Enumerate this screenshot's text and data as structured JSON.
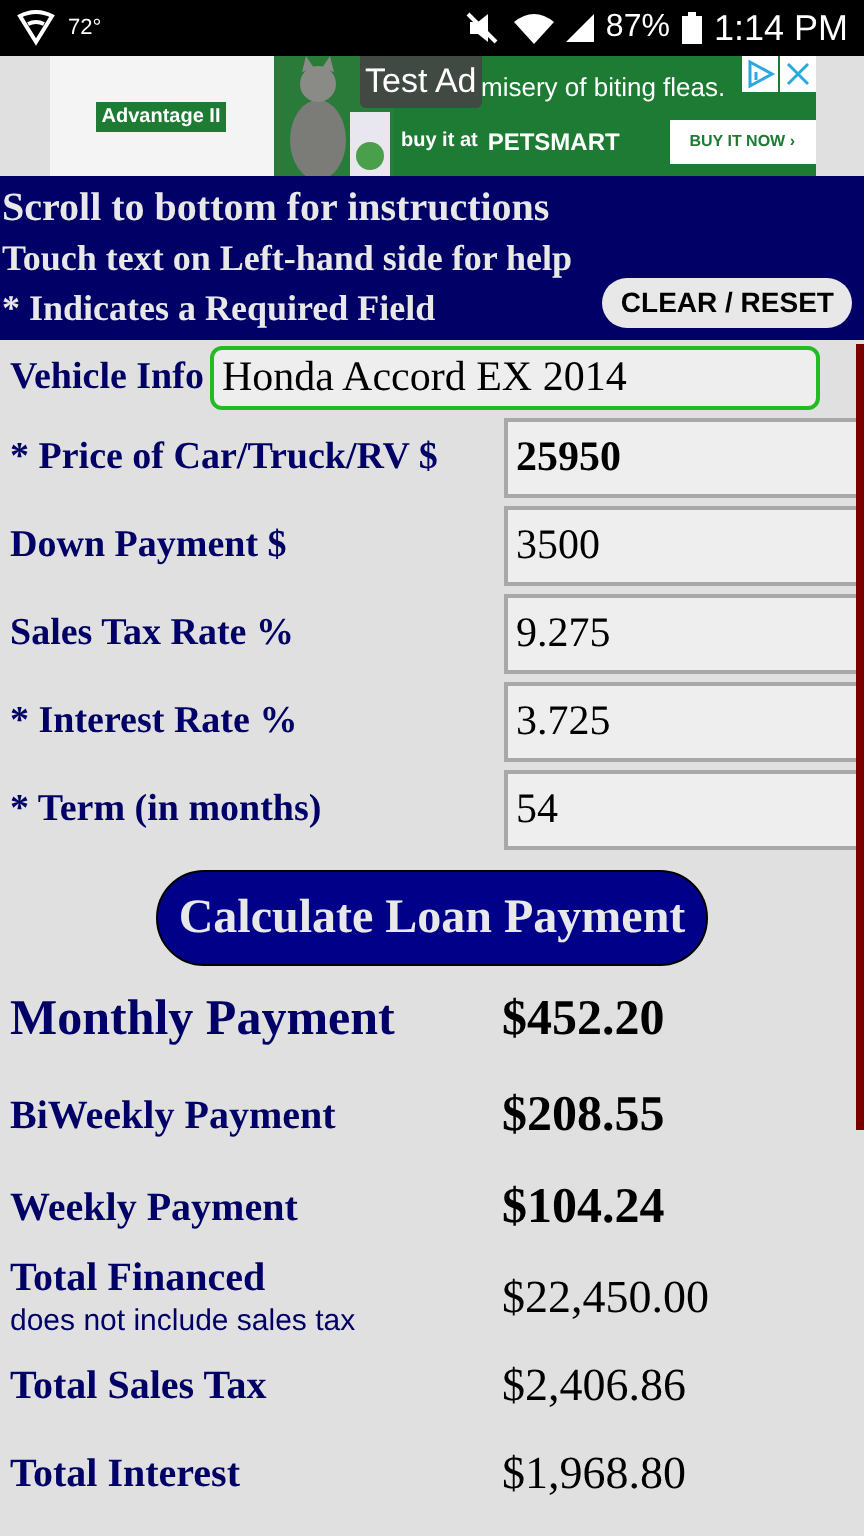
{
  "status_bar": {
    "temperature": "72°",
    "battery": "87%",
    "time": "1:14 PM"
  },
  "ad": {
    "label": "Test Ad",
    "brand": "Advantage II",
    "headline": "misery of biting fleas.",
    "buy_at": "buy it at",
    "store": "PETSMART",
    "cta": "BUY IT NOW ›"
  },
  "header": {
    "lines": [
      "Scroll to bottom for instructions",
      "Touch text on Left-hand side for help",
      "* Indicates a Required Field"
    ],
    "reset_button": "CLEAR / RESET"
  },
  "fields": [
    {
      "kind": "wide",
      "label": "Vehicle Info",
      "value": "Honda Accord EX 2014",
      "focused": true,
      "bold": false
    },
    {
      "kind": "box",
      "label": "* Price of Car/Truck/RV $",
      "value": "25950",
      "focused": false,
      "bold": true
    },
    {
      "kind": "box",
      "label": "Down Payment $",
      "value": "3500",
      "focused": false,
      "bold": false
    },
    {
      "kind": "box",
      "label": "Sales Tax Rate %",
      "value": "9.275",
      "focused": false,
      "bold": false
    },
    {
      "kind": "box",
      "label": "* Interest Rate %",
      "value": "3.725",
      "focused": false,
      "bold": false
    },
    {
      "kind": "box",
      "label": "* Term (in months)",
      "value": "54",
      "focused": false,
      "bold": false
    }
  ],
  "calculate_button": "Calculate Loan Payment",
  "results": [
    {
      "kind": "primary",
      "label": "Monthly Payment",
      "value": "$452.20"
    },
    {
      "kind": "secondary",
      "label": "BiWeekly Payment",
      "value": "$208.55"
    },
    {
      "kind": "secondary",
      "label": "Weekly Payment",
      "value": "$104.24"
    },
    {
      "kind": "total",
      "label": "Total Financed",
      "note": "does not include sales tax",
      "value": "$22,450.00"
    },
    {
      "kind": "total",
      "label": "Total Sales Tax",
      "value": "$2,406.86"
    },
    {
      "kind": "total",
      "label": "Total Interest",
      "value": "$1,968.80"
    }
  ]
}
